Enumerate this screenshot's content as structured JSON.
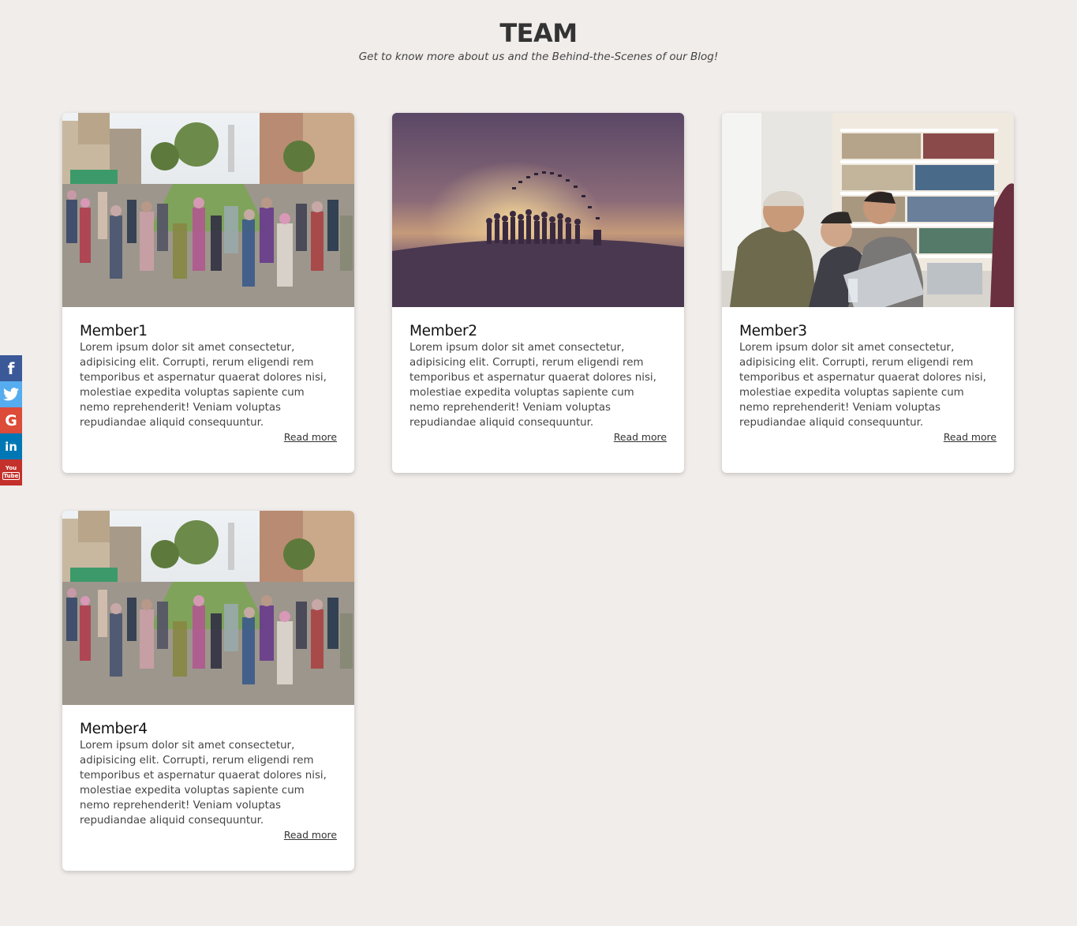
{
  "header": {
    "title": "TEAM",
    "subtitle": "Get to know more about us and the Behind-the-Scenes of our Blog!"
  },
  "cards": [
    {
      "name": "Member1",
      "text": "Lorem ipsum dolor sit amet consectetur, adipisicing elit. Corrupti, rerum eligendi rem temporibus et aspernatur quaerat dolores nisi, molestiae expedita voluptas sapiente cum nemo reprehenderit! Veniam voluptas repudiandae aliquid consequuntur.",
      "link": "Read more",
      "image": "crowd-street-photo"
    },
    {
      "name": "Member2",
      "text": "Lorem ipsum dolor sit amet consectetur, adipisicing elit. Corrupti, rerum eligendi rem temporibus et aspernatur quaerat dolores nisi, molestiae expedita voluptas sapiente cum nemo reprehenderit! Veniam voluptas repudiandae aliquid consequuntur.",
      "link": "Read more",
      "image": "graduation-silhouette-photo"
    },
    {
      "name": "Member3",
      "text": "Lorem ipsum dolor sit amet consectetur, adipisicing elit. Corrupti, rerum eligendi rem temporibus et aspernatur quaerat dolores nisi, molestiae expedita voluptas sapiente cum nemo reprehenderit! Veniam voluptas repudiandae aliquid consequuntur.",
      "link": "Read more",
      "image": "friends-laptop-library-photo"
    },
    {
      "name": "Member4",
      "text": "Lorem ipsum dolor sit amet consectetur, adipisicing elit. Corrupti, rerum eligendi rem temporibus et aspernatur quaerat dolores nisi, molestiae expedita voluptas sapiente cum nemo reprehenderit! Veniam voluptas repudiandae aliquid consequuntur.",
      "link": "Read more",
      "image": "crowd-street-photo"
    }
  ],
  "social": {
    "items": [
      "facebook-icon",
      "twitter-icon",
      "google-icon",
      "linkedin-icon",
      "youtube-icon"
    ],
    "youtube_text_1": "You",
    "youtube_text_2": "Tube"
  },
  "colors": {
    "background": "#f0edeb",
    "facebook": "#3b5998",
    "twitter": "#55acee",
    "google": "#dd4b39",
    "linkedin": "#0077b5",
    "youtube": "#c4302b"
  }
}
